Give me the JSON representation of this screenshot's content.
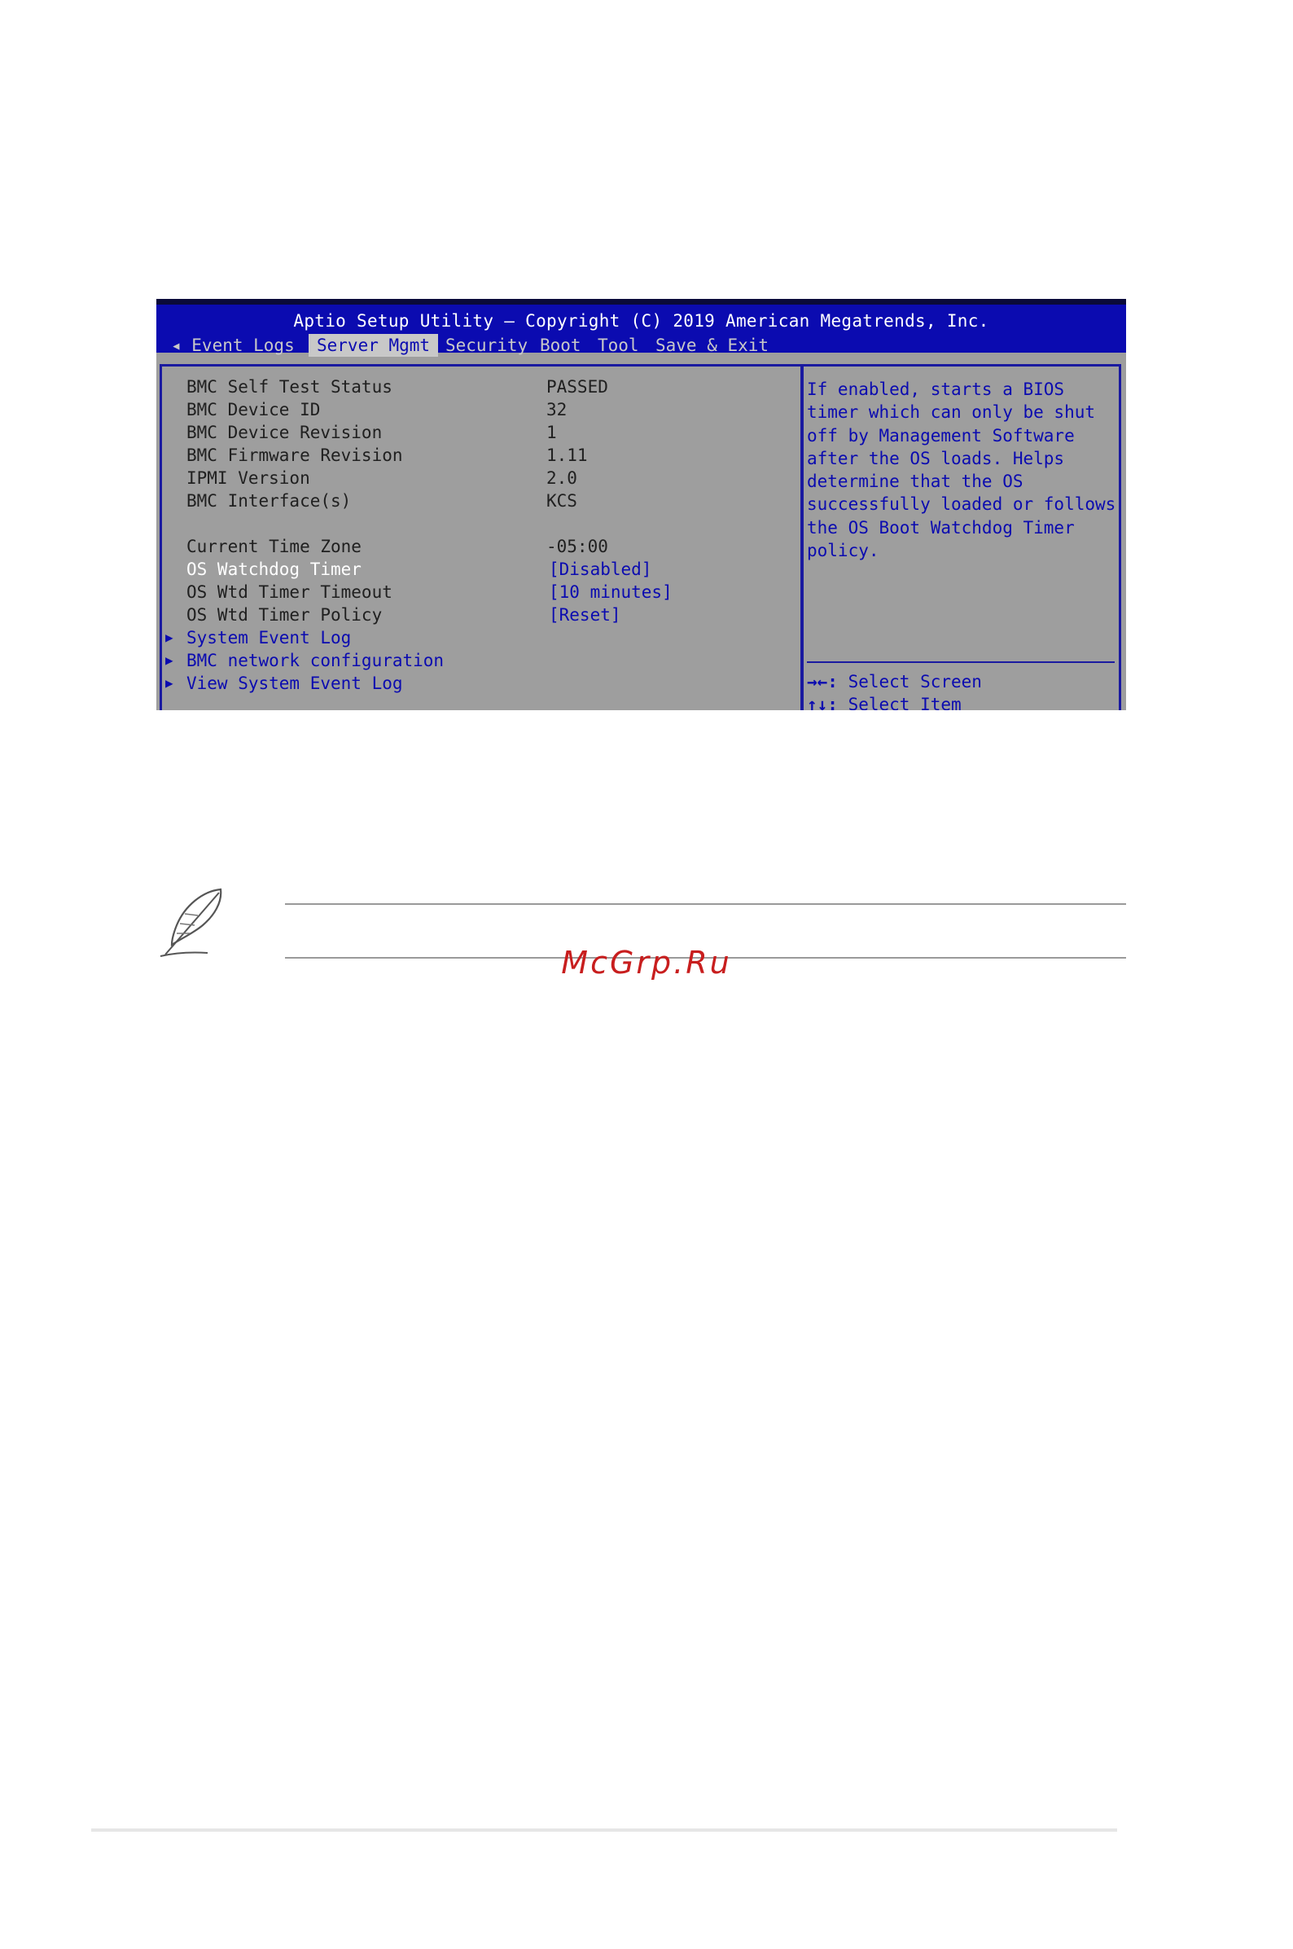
{
  "bios": {
    "title": "Aptio Setup Utility – Copyright (C) 2019 American Megatrends, Inc.",
    "tabs": [
      {
        "label": "◂ Event Logs"
      },
      {
        "label": "Server Mgmt"
      },
      {
        "label": "Security"
      },
      {
        "label": "Boot"
      },
      {
        "label": "Tool"
      },
      {
        "label": "Save & Exit"
      }
    ],
    "rows": [
      {
        "label": "BMC Self Test Status",
        "value": "PASSED"
      },
      {
        "label": "BMC Device ID",
        "value": "32"
      },
      {
        "label": "BMC Device Revision",
        "value": "1"
      },
      {
        "label": "BMC Firmware Revision",
        "value": "1.11"
      },
      {
        "label": "IPMI Version",
        "value": "2.0"
      },
      {
        "label": "BMC Interface(s)",
        "value": "KCS"
      },
      {
        "label": "Current Time Zone",
        "value": "-05:00"
      },
      {
        "label": "OS Watchdog Timer",
        "value": "[Disabled]"
      },
      {
        "label": "OS Wtd Timer Timeout",
        "value": "[10 minutes]"
      },
      {
        "label": "OS Wtd Timer Policy",
        "value": "[Reset]"
      }
    ],
    "submenus": [
      {
        "label": "System Event Log"
      },
      {
        "label": "BMC network configuration"
      },
      {
        "label": "View System Event Log"
      }
    ],
    "help_text": "If enabled, starts a BIOS\ntimer which can only be shut\noff by Management Software\nafter the OS loads.  Helps\ndetermine that the OS\nsuccessfully loaded or follows\nthe OS Boot Watchdog Timer\npolicy.",
    "keys": [
      {
        "key": "→←:",
        "desc": " Select Screen"
      },
      {
        "key": "↑↓:",
        "desc": " Select Item"
      }
    ]
  },
  "watermark": "McGrp.Ru",
  "colors": {
    "bios_blue": "#0b0bb0",
    "bios_gray": "#9e9e9e",
    "watermark_red": "#c81e1e"
  },
  "icons": {
    "note": "feather-quill-icon",
    "submenu": "triangle-right-icon"
  }
}
